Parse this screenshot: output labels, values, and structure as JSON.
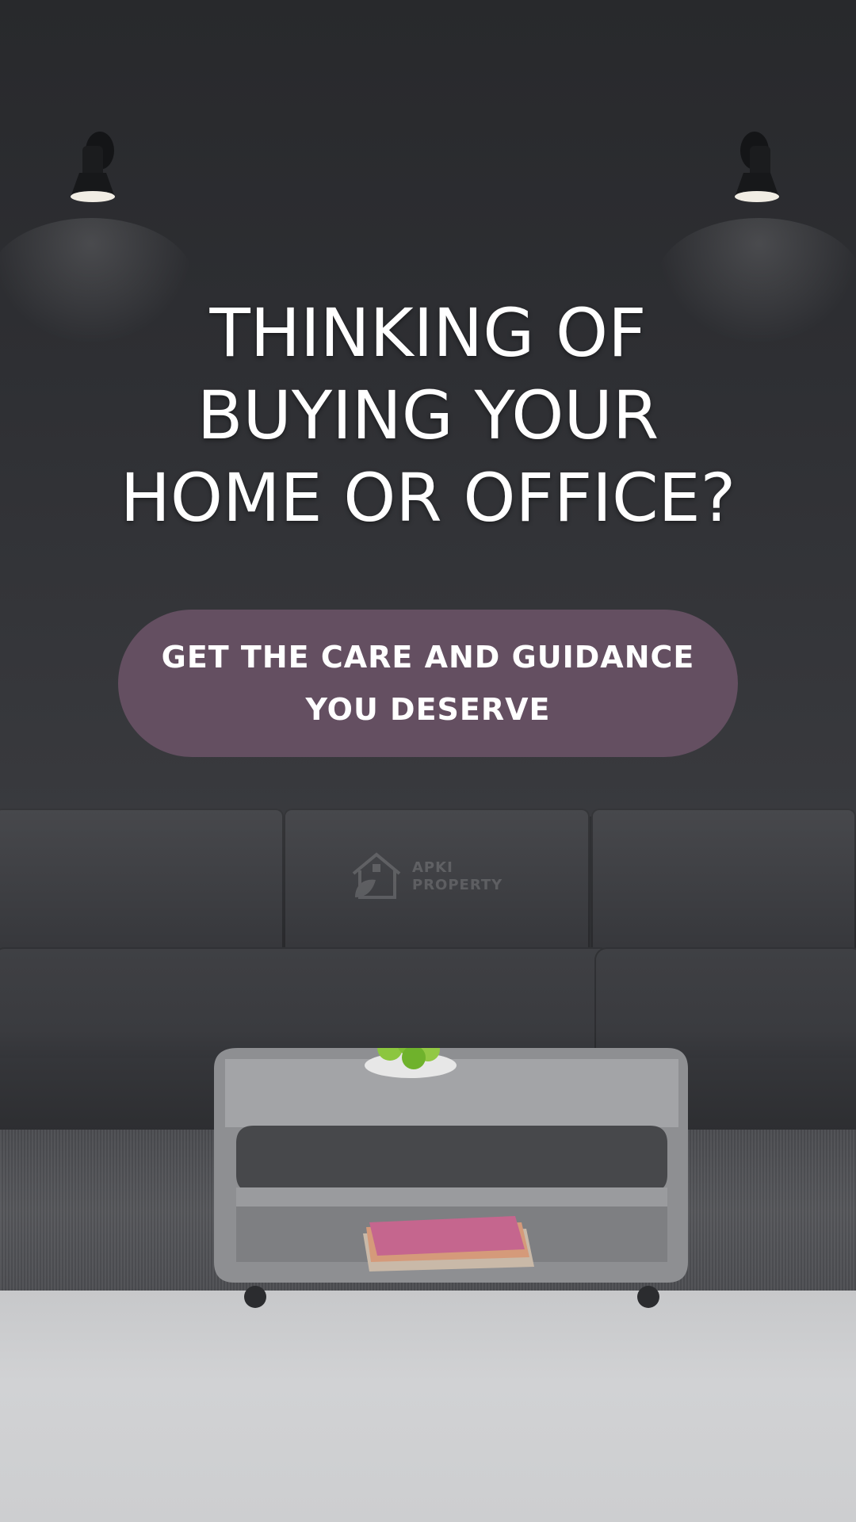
{
  "headline": {
    "line1": "THINKING OF",
    "line2": "BUYING YOUR",
    "line3": "HOME OR OFFICE?"
  },
  "cta": {
    "line1": "GET THE CARE AND GUIDANCE",
    "line2": "YOU DESERVE"
  },
  "watermark": {
    "line1": "APKI",
    "line2": "PROPERTY",
    "icon": "house-leaf-icon"
  },
  "colors": {
    "cta_background": "#644f61",
    "wall": "#2f3033",
    "text": "#ffffff"
  },
  "icons": {
    "lamps": "wall-lamp-icon"
  }
}
